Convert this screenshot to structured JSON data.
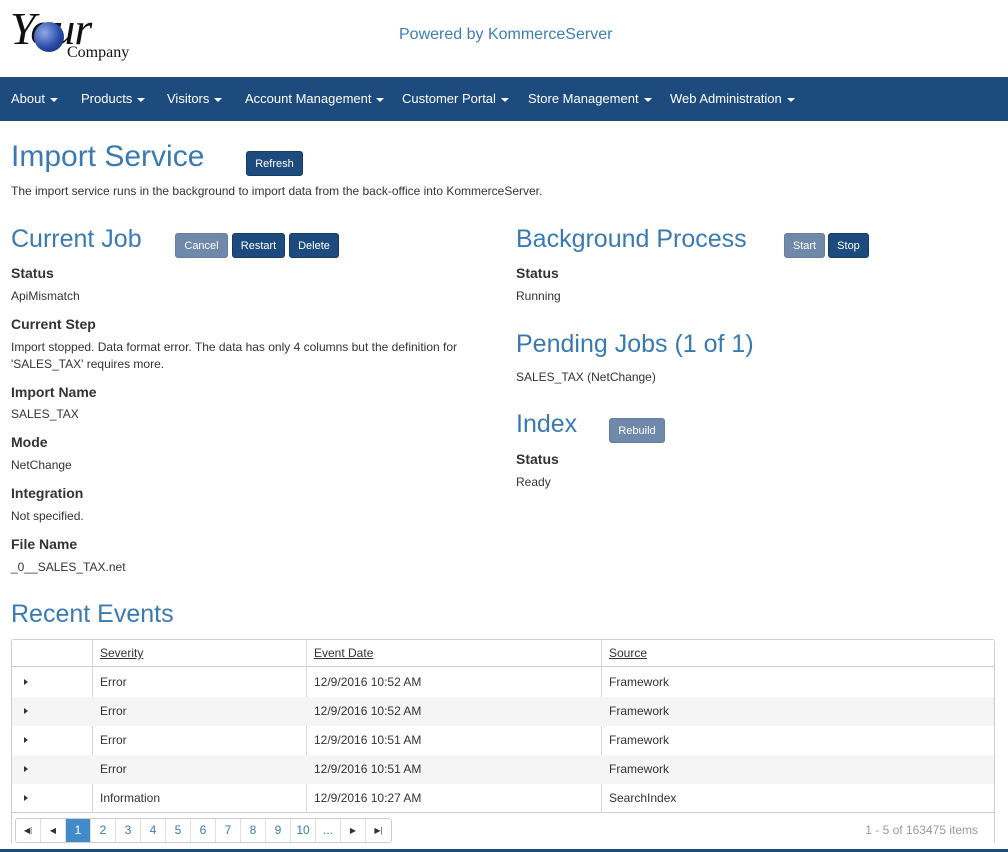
{
  "header": {
    "logo_your": "Your",
    "logo_company": "Company",
    "powered_by": "Powered by KommerceServer"
  },
  "nav": {
    "items": [
      {
        "label": "About"
      },
      {
        "label": "Products"
      },
      {
        "label": "Visitors"
      },
      {
        "label": "Account Management"
      },
      {
        "label": "Customer Portal"
      },
      {
        "label": "Store Management"
      },
      {
        "label": "Web Administration"
      }
    ]
  },
  "page": {
    "title": "Import Service",
    "refresh_label": "Refresh",
    "description": "The import service runs in the background to import data from the back-office into KommerceServer."
  },
  "current_job": {
    "title": "Current Job",
    "cancel_label": "Cancel",
    "restart_label": "Restart",
    "delete_label": "Delete",
    "status_label": "Status",
    "status_value": "ApiMismatch",
    "step_label": "Current Step",
    "step_value_line1": "Import stopped. Data format error. The data has only 4 columns but the definition for",
    "step_value_line2": "'SALES_TAX' requires more.",
    "import_name_label": "Import Name",
    "import_name_value": "SALES_TAX",
    "mode_label": "Mode",
    "mode_value": "NetChange",
    "integration_label": "Integration",
    "integration_value": "Not specified.",
    "file_name_label": "File Name",
    "file_name_value": "_0__SALES_TAX.net"
  },
  "background_process": {
    "title": "Background Process",
    "start_label": "Start",
    "stop_label": "Stop",
    "status_label": "Status",
    "status_value": "Running"
  },
  "pending_jobs": {
    "title": "Pending Jobs (1 of 1)",
    "items": [
      "SALES_TAX (NetChange)"
    ]
  },
  "index": {
    "title": "Index",
    "rebuild_label": "Rebuild",
    "status_label": "Status",
    "status_value": "Ready"
  },
  "recent_events": {
    "title": "Recent Events",
    "columns": [
      "Severity",
      "Event Date",
      "Source"
    ],
    "rows": [
      {
        "severity": "Error",
        "date": "12/9/2016 10:52 AM",
        "source": "Framework"
      },
      {
        "severity": "Error",
        "date": "12/9/2016 10:52 AM",
        "source": "Framework"
      },
      {
        "severity": "Error",
        "date": "12/9/2016 10:51 AM",
        "source": "Framework"
      },
      {
        "severity": "Error",
        "date": "12/9/2016 10:51 AM",
        "source": "Framework"
      },
      {
        "severity": "Information",
        "date": "12/9/2016 10:27 AM",
        "source": "SearchIndex"
      }
    ],
    "pager": {
      "pages": [
        "1",
        "2",
        "3",
        "4",
        "5",
        "6",
        "7",
        "8",
        "9",
        "10",
        "..."
      ],
      "current_page": "1",
      "info": "1 - 5 of 163475 items"
    }
  },
  "colors": {
    "navbar": "#1e4b7d",
    "heading": "#3a7ab3",
    "button_dark": "#1e4b7d",
    "button_light": "#7088a9",
    "pager_active": "#428bca"
  }
}
